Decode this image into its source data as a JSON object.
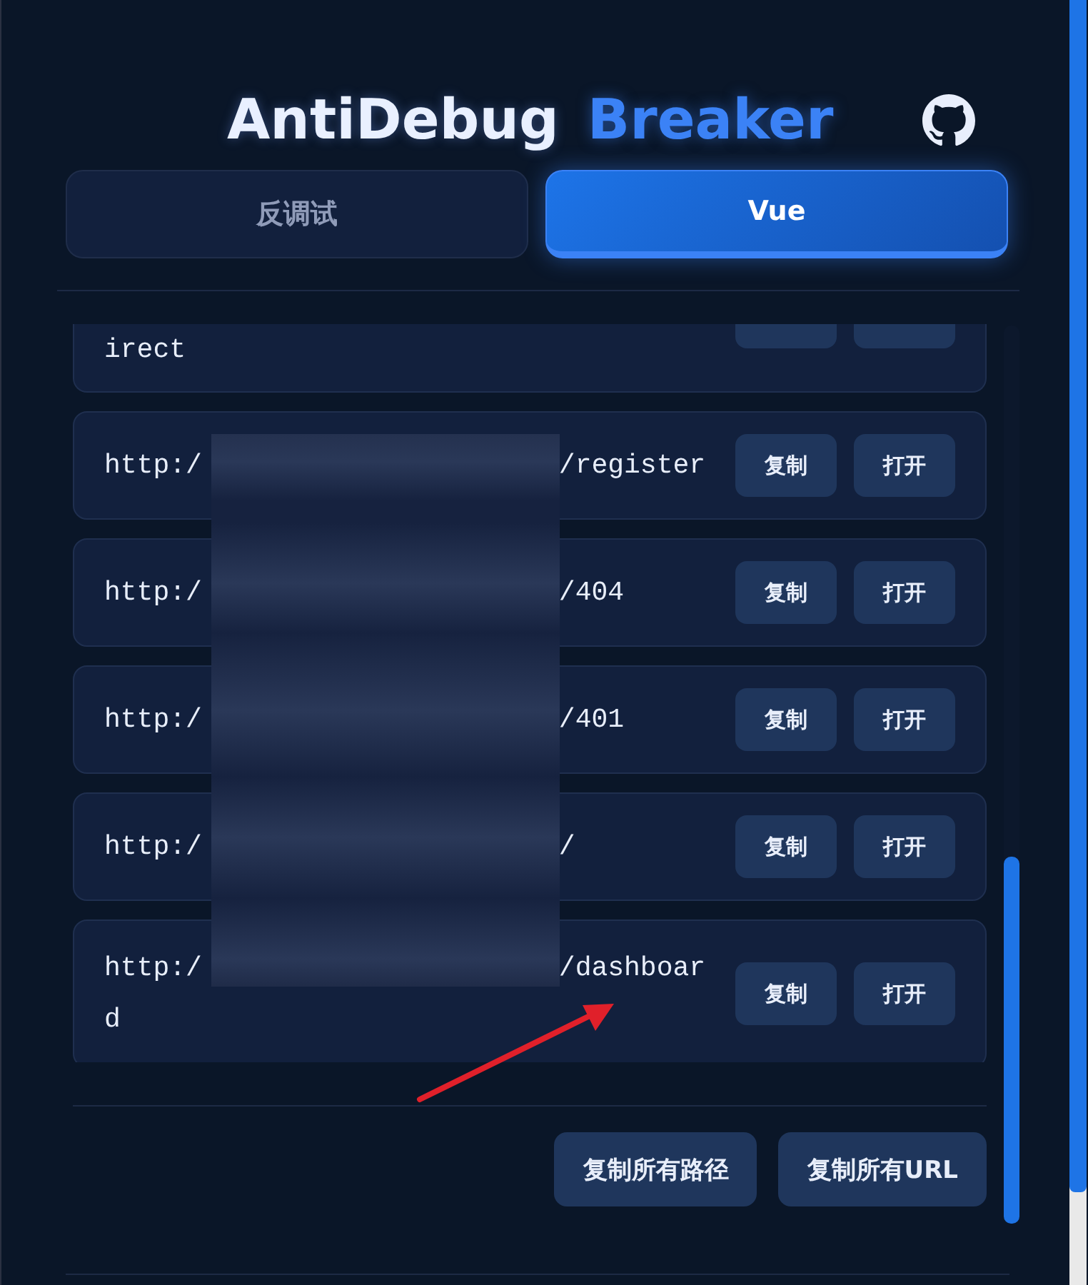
{
  "header": {
    "title": "AntiDebug",
    "title_accent": "Breaker"
  },
  "tabs": [
    {
      "label": "反调试",
      "selected": false
    },
    {
      "label": "Vue",
      "selected": true
    }
  ],
  "routes": [
    {
      "clipped": true,
      "lines": [
        [
          "irect"
        ]
      ]
    },
    {
      "clipped": false,
      "lines": [
        [
          "http:/",
          "/register"
        ]
      ],
      "actions": [
        "复制",
        "打开"
      ]
    },
    {
      "clipped": false,
      "lines": [
        [
          "http:/",
          "/404"
        ]
      ],
      "actions": [
        "复制",
        "打开"
      ]
    },
    {
      "clipped": false,
      "lines": [
        [
          "http:/",
          "/401"
        ]
      ],
      "actions": [
        "复制",
        "打开"
      ]
    },
    {
      "clipped": false,
      "lines": [
        [
          "http:/",
          "/"
        ]
      ],
      "actions": [
        "复制",
        "打开"
      ]
    },
    {
      "clipped": false,
      "lines": [
        [
          "http:/",
          "/dashboar"
        ],
        [
          "d"
        ]
      ],
      "actions": [
        "复制",
        "打开"
      ]
    }
  ],
  "redaction": {
    "kind": "blur"
  },
  "annotation": {
    "kind": "arrow"
  },
  "footer_buttons": [
    "复制所有路径",
    "复制所有URL"
  ]
}
